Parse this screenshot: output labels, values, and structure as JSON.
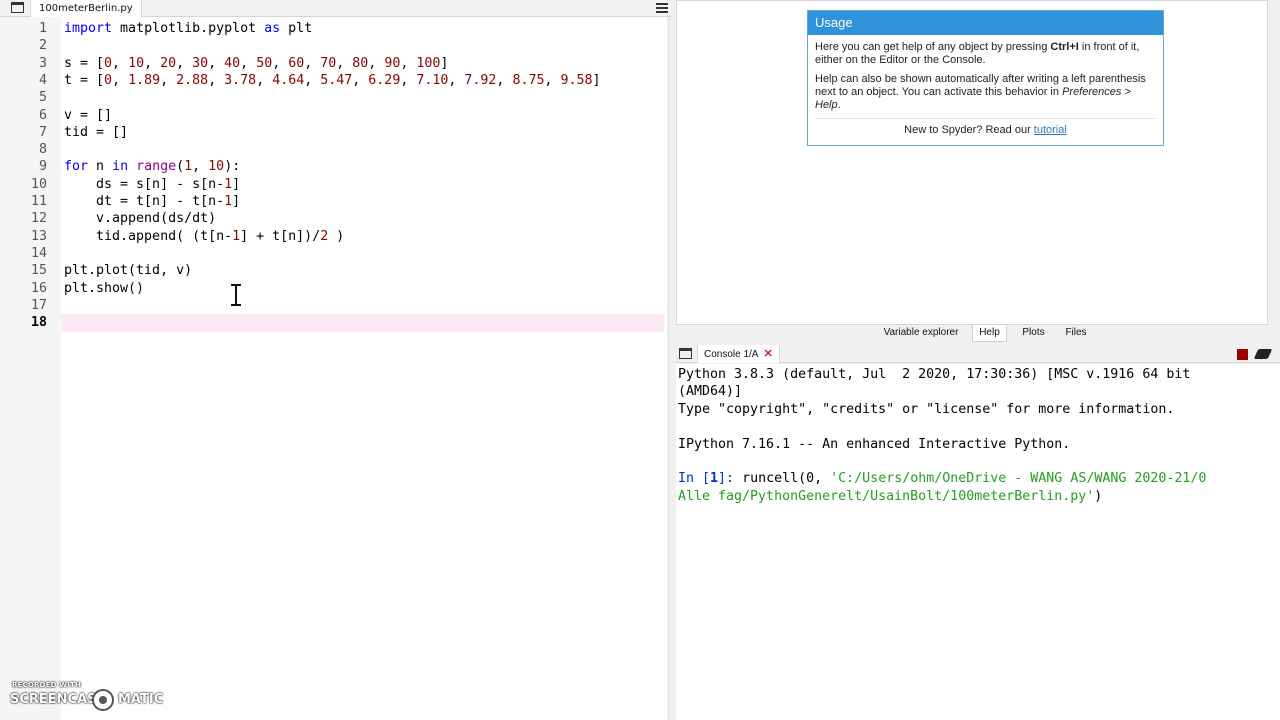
{
  "editor": {
    "file_tab": "100meterBerlin.py",
    "file_tab_close": "✕",
    "line_numbers": [
      "1",
      "2",
      "3",
      "4",
      "5",
      "6",
      "7",
      "8",
      "9",
      "10",
      "11",
      "12",
      "13",
      "14",
      "15",
      "16",
      "17",
      "18"
    ],
    "lines": {
      "l1_import": "import",
      "l1_mod": " matplotlib.pyplot ",
      "l1_as": "as",
      "l1_alias": " plt",
      "l3_a": "s = [",
      "l3_nums": [
        "0",
        "10",
        "20",
        "30",
        "40",
        "50",
        "60",
        "70",
        "80",
        "90",
        "100"
      ],
      "l4_a": "t = [",
      "l4_nums": [
        "0",
        "1.89",
        "2.88",
        "3.78",
        "4.64",
        "5.47",
        "6.29",
        "7.10",
        "7.92",
        "8.75",
        "9.58"
      ],
      "l6": "v = []",
      "l7": "tid = []",
      "l9_for": "for",
      "l9_n": " n ",
      "l9_in": "in",
      "l9_range": " range",
      "l9_open": "(",
      "l9_one": "1",
      "l9_comma": ", ",
      "l9_ten": "10",
      "l9_close": "):",
      "l10_a": "    ds = s[n] - s[n-",
      "l10_one": "1",
      "l10_b": "]",
      "l11_a": "    dt = t[n] - t[n-",
      "l11_one": "1",
      "l11_b": "]",
      "l12": "    v.append(ds/dt)",
      "l13_a": "    tid.append( (t[n-",
      "l13_one": "1",
      "l13_b": "] + t[n])/",
      "l13_two": "2",
      "l13_c": " )",
      "l15": "plt.plot(tid, v)",
      "l16": "plt.show()"
    }
  },
  "watermark": {
    "top": "RECORDED WITH",
    "main": "SCREENCAST",
    "end": "MATIC"
  },
  "help": {
    "title": "Usage",
    "p1_a": "Here you can get help of any object by pressing ",
    "p1_key": "Ctrl+I",
    "p1_b": " in front of it, either on the Editor or the Console.",
    "p2_a": "Help can also be shown automatically after writing a left parenthesis next to an object. You can activate this behavior in ",
    "p2_pref": "Preferences > Help",
    "p2_b": ".",
    "footer_a": "New to Spyder? Read our ",
    "footer_link": "tutorial"
  },
  "right_tabs": [
    "Variable explorer",
    "Help",
    "Plots",
    "Files"
  ],
  "console": {
    "tab": "Console 1/A",
    "tab_close": "✕",
    "l1": "Python 3.8.3 (default, Jul  2 2020, 17:30:36) [MSC v.1916 64 bit",
    "l2": "(AMD64)]",
    "l3": "Type \"copyright\", \"credits\" or \"license\" for more information.",
    "l5": "IPython 7.16.1 -- An enhanced Interactive Python.",
    "prompt_a": "In [",
    "prompt_n": "1",
    "prompt_b": "]: ",
    "cmd_a": "runcell(",
    "cmd_zero": "0",
    "cmd_b": ", ",
    "cmd_path1": "'C:/Users/ohm/OneDrive - WANG AS/WANG 2020-21/0",
    "cmd_path2": "Alle fag/PythonGenerelt/UsainBolt/100meterBerlin.py'",
    "cmd_end": ")"
  }
}
